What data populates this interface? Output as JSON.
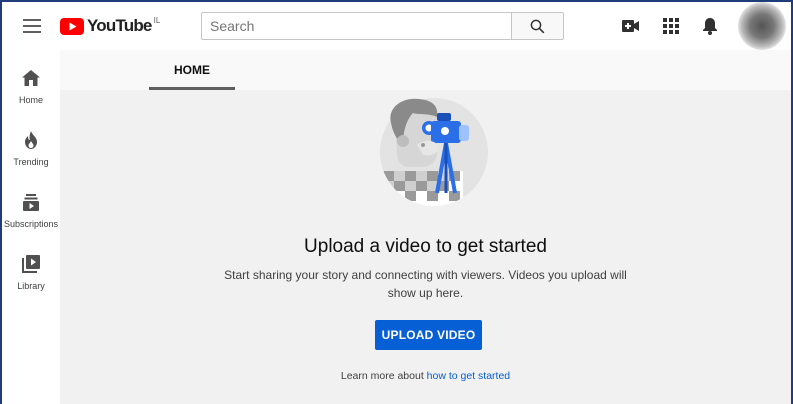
{
  "header": {
    "logo_text": "YouTube",
    "logo_country": "IL",
    "search_placeholder": "Search"
  },
  "icons": {
    "menu": "hamburger-menu-icon",
    "search": "search-icon",
    "create": "video-camera-plus-icon",
    "apps": "apps-grid-icon",
    "notifications": "bell-icon"
  },
  "sidebar": {
    "items": [
      {
        "label": "Home",
        "icon": "home-icon"
      },
      {
        "label": "Trending",
        "icon": "flame-icon"
      },
      {
        "label": "Subscriptions",
        "icon": "subscriptions-icon"
      },
      {
        "label": "Library",
        "icon": "library-icon"
      }
    ]
  },
  "tabs": {
    "home": "HOME"
  },
  "main": {
    "headline": "Upload a video to get started",
    "subtext": "Start sharing your story and connecting with viewers. Videos you upload will show up here.",
    "upload_button": "UPLOAD VIDEO",
    "learn_prefix": "Learn more about ",
    "learn_link": "how to get started"
  },
  "colors": {
    "accent": "#065fd4",
    "brand_red": "#ff0000",
    "main_bg": "#f1f1f1"
  }
}
